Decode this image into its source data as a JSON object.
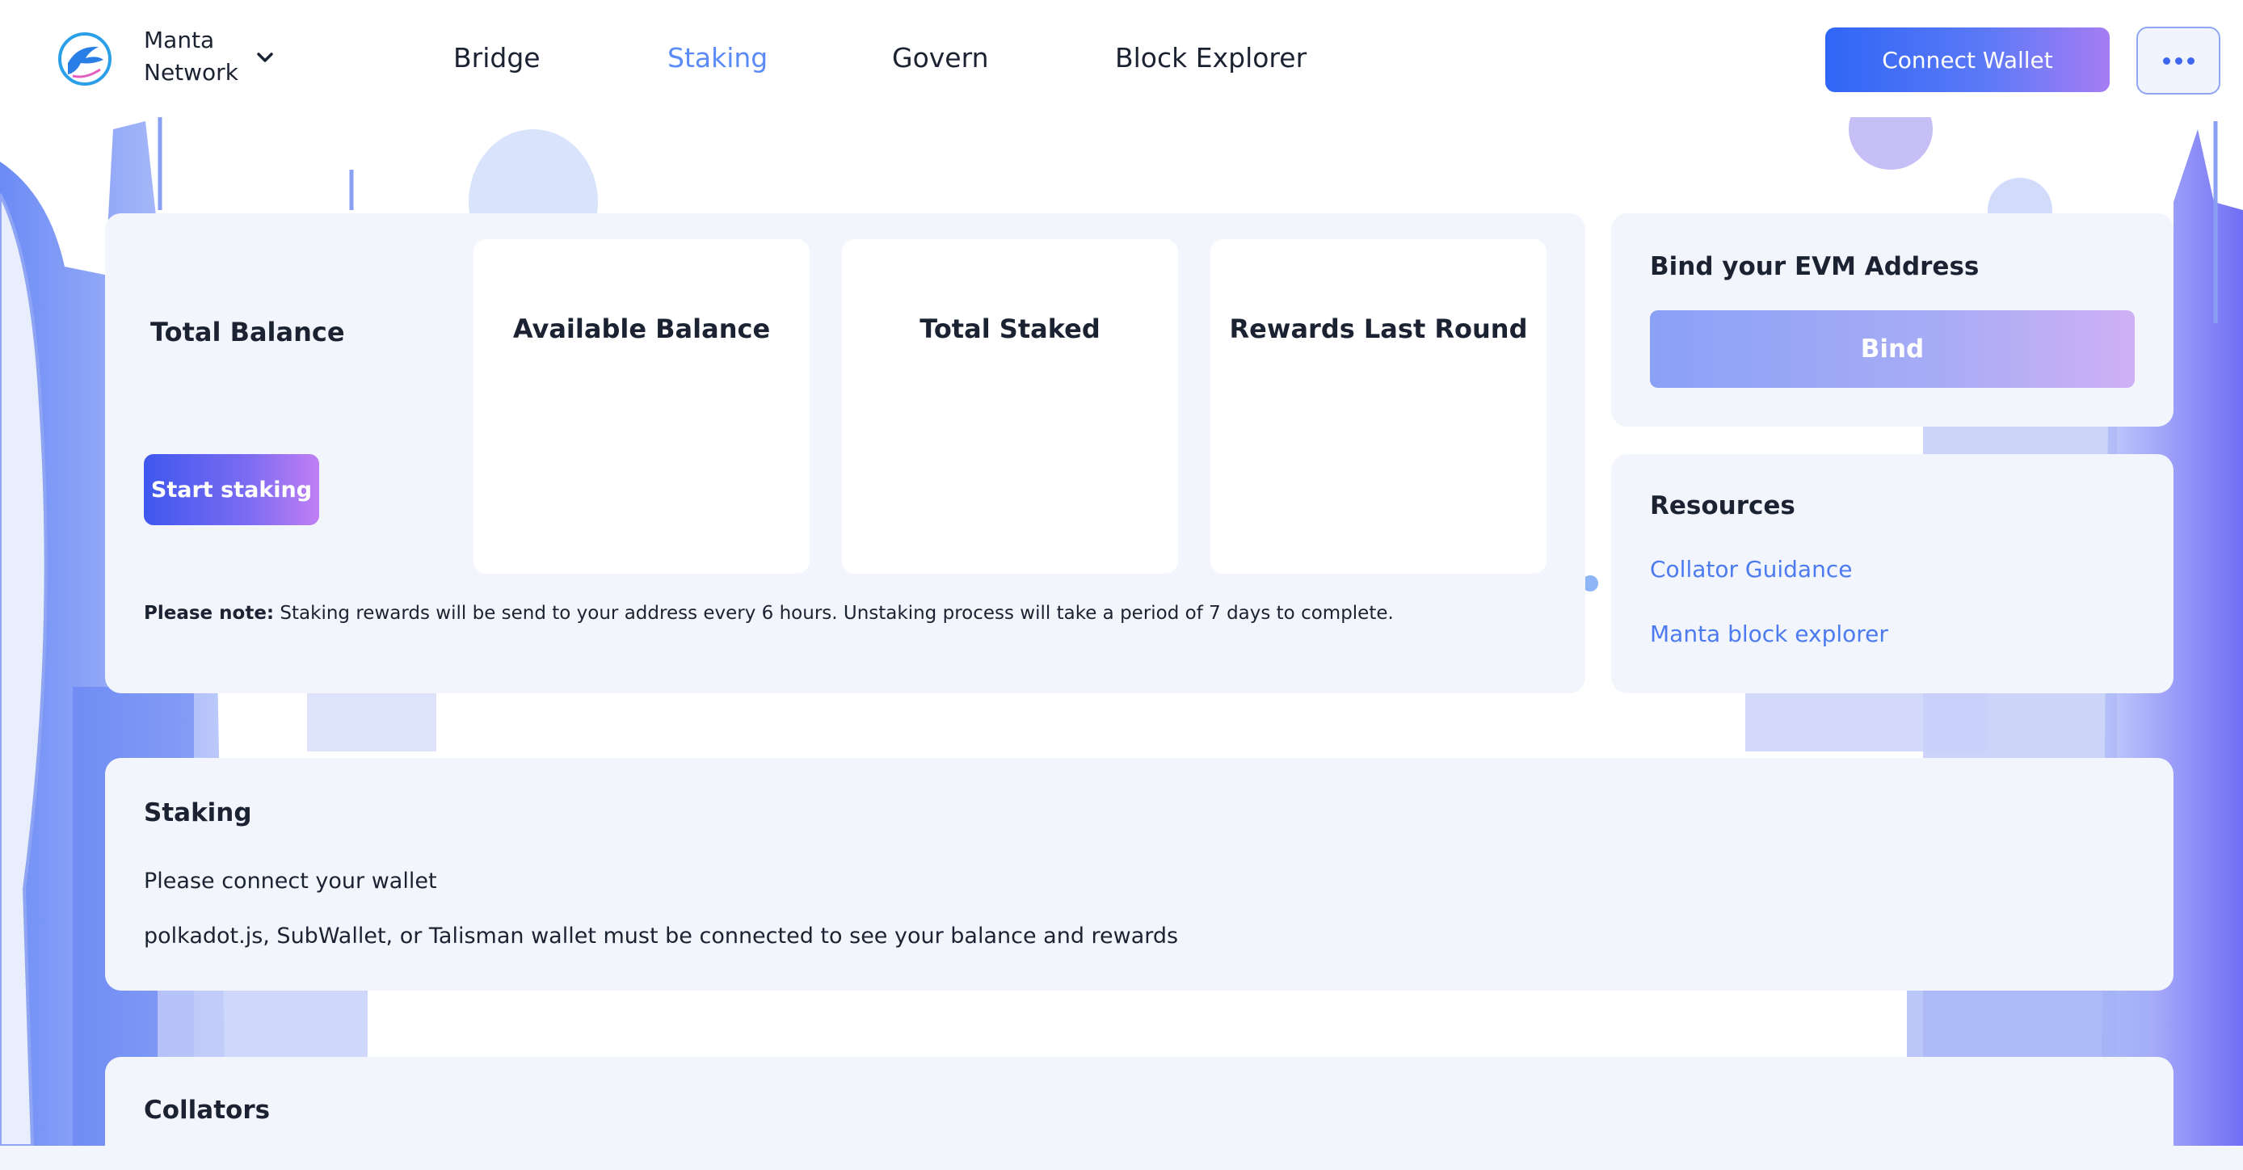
{
  "header": {
    "network_name_line1": "Manta",
    "network_name_line2": "Network",
    "nav": [
      {
        "label": "Bridge",
        "active": false
      },
      {
        "label": "Staking",
        "active": true
      },
      {
        "label": "Govern",
        "active": false
      },
      {
        "label": "Block Explorer",
        "active": false
      }
    ],
    "connect_wallet_label": "Connect Wallet"
  },
  "balances": {
    "total_balance_label": "Total Balance",
    "start_staking_label": "Start staking",
    "cards": [
      {
        "title": "Available Balance"
      },
      {
        "title": "Total Staked"
      },
      {
        "title": "Rewards Last Round"
      }
    ],
    "note_prefix": "Please note:",
    "note_text": " Staking rewards will be send to your address every 6 hours. Unstaking process will take a period of 7 days to complete."
  },
  "bind": {
    "title": "Bind your EVM Address",
    "button_label": "Bind"
  },
  "resources": {
    "title": "Resources",
    "links": [
      "Collator Guidance",
      "Manta block explorer"
    ]
  },
  "staking": {
    "title": "Staking",
    "message": "Please connect your wallet",
    "detail": "polkadot.js, SubWallet, or Talisman wallet must be connected to see your balance and rewards"
  },
  "collators": {
    "title": "Collators"
  },
  "colors": {
    "accent": "#5b8bf7",
    "link": "#4b7bef",
    "panel": "#f3f5fd"
  }
}
